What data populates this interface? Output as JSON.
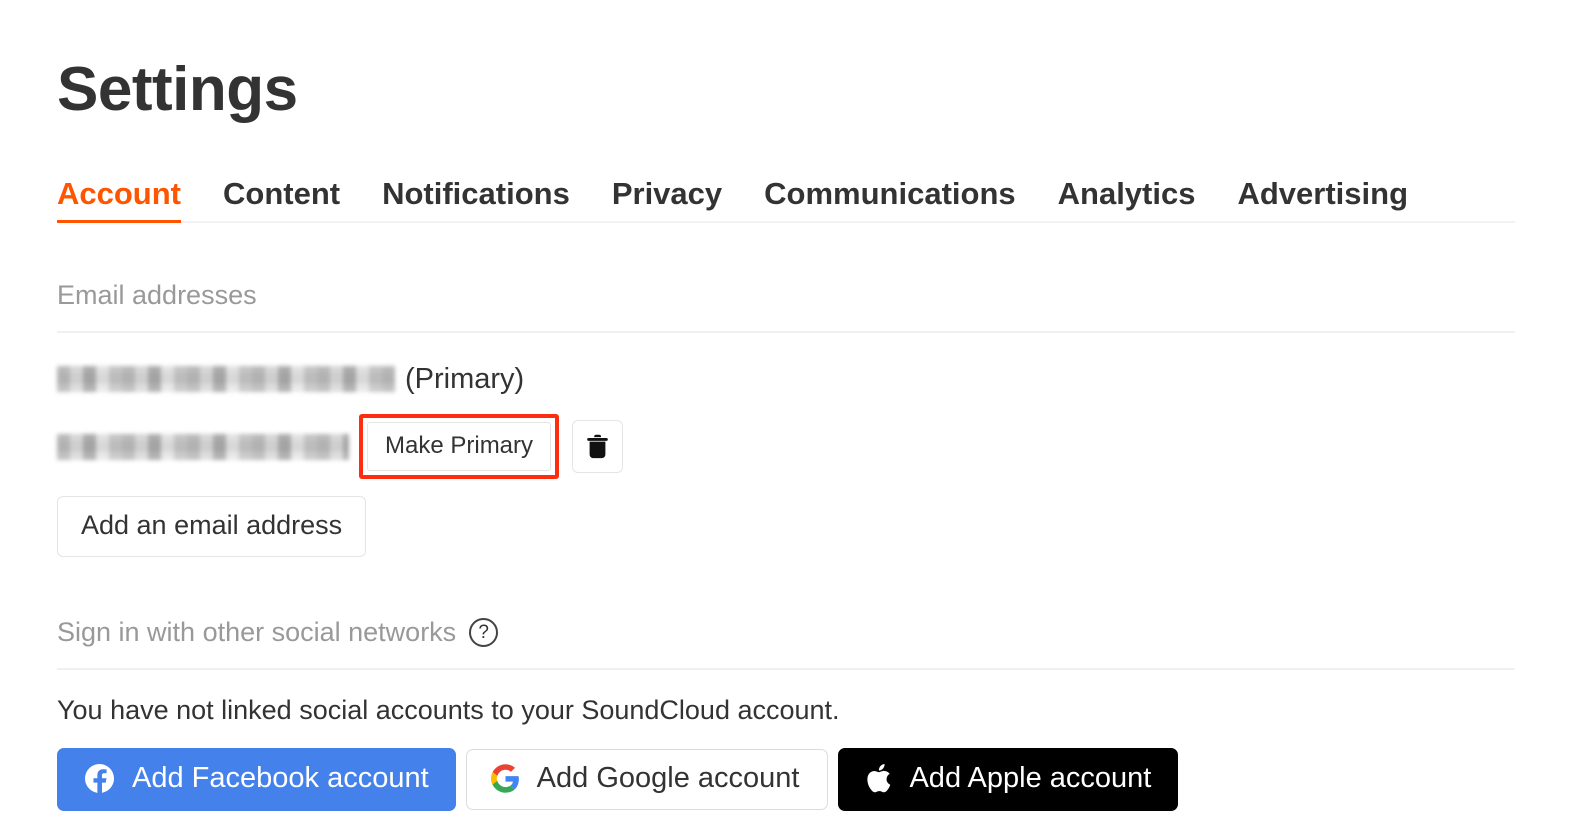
{
  "page": {
    "title": "Settings"
  },
  "tabs": {
    "active_index": 0,
    "items": [
      {
        "label": "Account"
      },
      {
        "label": "Content"
      },
      {
        "label": "Notifications"
      },
      {
        "label": "Privacy"
      },
      {
        "label": "Communications"
      },
      {
        "label": "Analytics"
      },
      {
        "label": "Advertising"
      }
    ]
  },
  "email_section": {
    "heading": "Email addresses",
    "rows": [
      {
        "address": "",
        "address_redacted": true,
        "primary_label": "(Primary)",
        "is_primary": true
      },
      {
        "address": "",
        "address_redacted": true,
        "make_primary_label": "Make Primary",
        "delete_icon": "trash-icon",
        "is_primary": false
      }
    ],
    "add_email_label": "Add an email address"
  },
  "social_section": {
    "heading": "Sign in with other social networks",
    "help_icon": "question-mark-icon",
    "help_glyph": "?",
    "note": "You have not linked social accounts to your SoundCloud account.",
    "buttons": [
      {
        "label": "Add Facebook account",
        "icon": "facebook-icon",
        "bg": "#4481eb",
        "fg": "#ffffff"
      },
      {
        "label": "Add Google account",
        "icon": "google-icon",
        "bg": "#ffffff",
        "fg": "#333333"
      },
      {
        "label": "Add Apple account",
        "icon": "apple-icon",
        "bg": "#000000",
        "fg": "#ffffff"
      }
    ]
  },
  "annotation": {
    "target": "Make Primary",
    "highlight_color": "#ff2d0f"
  },
  "theme": {
    "accent": "#ff5500",
    "text": "#333333",
    "muted": "#999999",
    "divider": "#f0f0f0"
  }
}
